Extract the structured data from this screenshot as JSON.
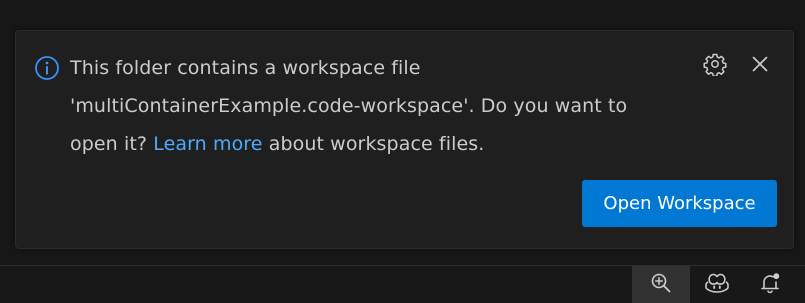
{
  "notification": {
    "message_line1": "This folder contains a workspace file",
    "message_line2": "'multiContainerExample.code-workspace'. Do you want to",
    "message_line3_prefix": "open it? ",
    "learn_more_link": "Learn more",
    "message_line3_suffix": " about workspace files.",
    "primary_button_label": "Open Workspace",
    "icons": {
      "info": "info-icon",
      "settings": "gear-icon",
      "close": "close-icon"
    },
    "colors": {
      "accent": "#0078d4",
      "link": "#4daafc",
      "info_icon": "#3794ff"
    }
  },
  "statusbar": {
    "items": [
      {
        "icon": "zoom-in-icon",
        "active": true
      },
      {
        "icon": "copilot-icon",
        "active": false
      },
      {
        "icon": "bell-dot-icon",
        "active": false
      }
    ]
  }
}
